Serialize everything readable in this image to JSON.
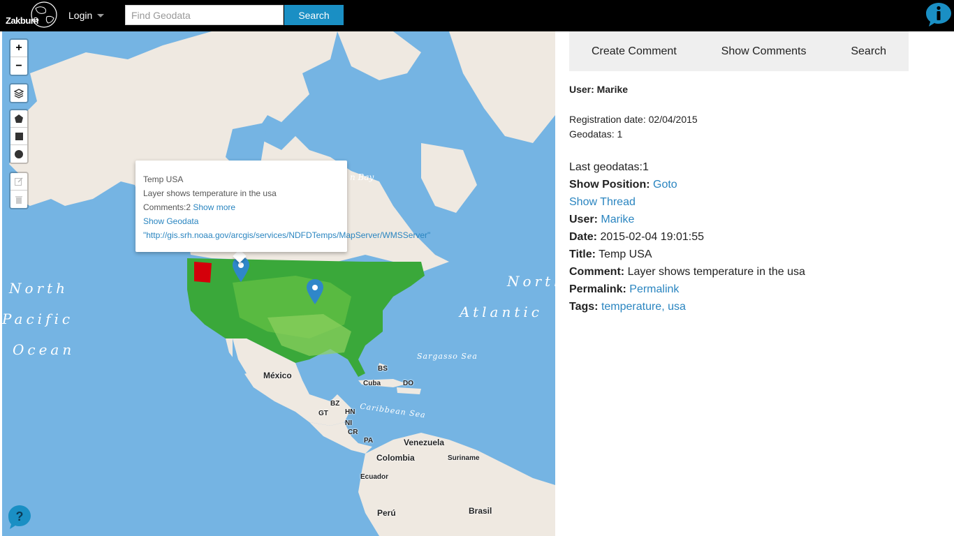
{
  "header": {
    "logo_text": "Zakbum",
    "login_label": "Login",
    "search_placeholder": "Find Geodata",
    "search_value": "",
    "search_button": "Search"
  },
  "map": {
    "labels": {
      "north": "North",
      "pacific": "Pacific",
      "ocean": "Ocean",
      "north_atlantic": "North",
      "atlantic": "Atlantic",
      "bay_partial": "n Bay",
      "bay_top": "n Bay",
      "sargasso": "Sargasso Sea",
      "caribbean": "Caribbean Sea",
      "mexico": "México",
      "cuba": "Cuba",
      "bs": "BS",
      "do": "DO",
      "bz": "BZ",
      "gt": "GT",
      "hn": "HN",
      "ni": "NI",
      "cr": "CR",
      "pa": "PA",
      "venezuela": "Venezuela",
      "colombia": "Colombia",
      "suriname": "Suriname",
      "ecuador": "Ecuador",
      "peru": "Perú",
      "brasil": "Brasil"
    },
    "controls": {
      "zoom_in": "+",
      "zoom_out": "−"
    },
    "popup": {
      "title": "Temp USA",
      "description": "Layer shows temperature in the usa",
      "comments_prefix": "Comments:2",
      "show_more": "Show more",
      "show_geodata": "Show Geodata",
      "url": "\"http://gis.srh.noaa.gov/arcgis/services/NDFDTemps/MapServer/WMSServer\""
    },
    "colors": {
      "water": "#75b4e3",
      "land": "#efe9e1",
      "overlay_green": "#2e9e2e",
      "highlight_red": "#d4000a",
      "marker": "#2f87c9"
    }
  },
  "panel": {
    "tabs": [
      "Create Comment",
      "Show Comments",
      "Search"
    ],
    "user_heading": "User: Marike",
    "registration": "Registration date: 02/04/2015",
    "geodatas": "Geodatas: 1",
    "last_geodatas": "Last geodatas:1",
    "show_position_label": "Show Position:",
    "show_position_link": "Goto",
    "show_thread": "Show Thread",
    "user_label": "User:",
    "user_link": "Marike",
    "date_label": "Date:",
    "date_value": "2015-02-04 19:01:55",
    "title_label": "Title:",
    "title_value": "Temp USA",
    "comment_label": "Comment:",
    "comment_value": "Layer shows temperature in the usa",
    "permalink_label": "Permalink:",
    "permalink_link": "Permalink",
    "tags_label": "Tags:",
    "tags_value": "temperature, usa"
  }
}
